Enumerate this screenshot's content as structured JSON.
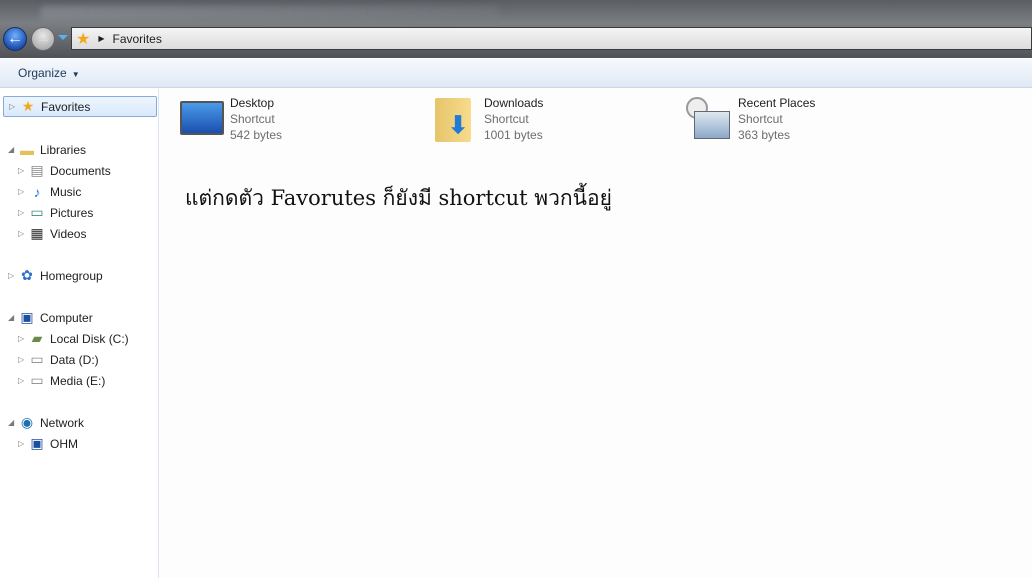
{
  "address": {
    "location": "Favorites"
  },
  "toolbar": {
    "organize": "Organize"
  },
  "nav": {
    "favorites": "Favorites",
    "libraries": "Libraries",
    "documents": "Documents",
    "music": "Music",
    "pictures": "Pictures",
    "videos": "Videos",
    "homegroup": "Homegroup",
    "computer": "Computer",
    "c": "Local Disk (C:)",
    "d": "Data (D:)",
    "e": "Media (E:)",
    "network": "Network",
    "ohm": "OHM"
  },
  "items": [
    {
      "name": "Desktop",
      "type": "Shortcut",
      "size": "542 bytes"
    },
    {
      "name": "Downloads",
      "type": "Shortcut",
      "size": "1001 bytes"
    },
    {
      "name": "Recent Places",
      "type": "Shortcut",
      "size": "363 bytes"
    }
  ],
  "annotation": "แต่กดตัว Favorutes ก็ยังมี shortcut พวกนี้อยู่"
}
